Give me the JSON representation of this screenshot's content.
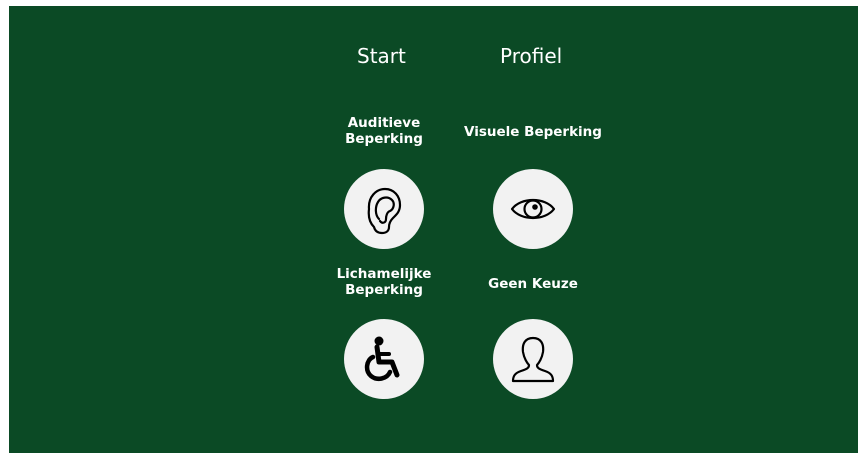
{
  "nav": {
    "start_label": "Start",
    "profile_label": "Profiel"
  },
  "options": [
    {
      "label": "Auditieve\nBeperking",
      "icon": "ear-icon"
    },
    {
      "label": "Visuele Beperking",
      "icon": "eye-icon"
    },
    {
      "label": "Lichamelijke\nBeperking",
      "icon": "wheelchair-icon"
    },
    {
      "label": "Geen Keuze",
      "icon": "person-icon"
    }
  ],
  "colors": {
    "background": "#0b4a25",
    "circle": "#f2f2f2",
    "text": "#ffffff",
    "icon_stroke": "#000000"
  }
}
